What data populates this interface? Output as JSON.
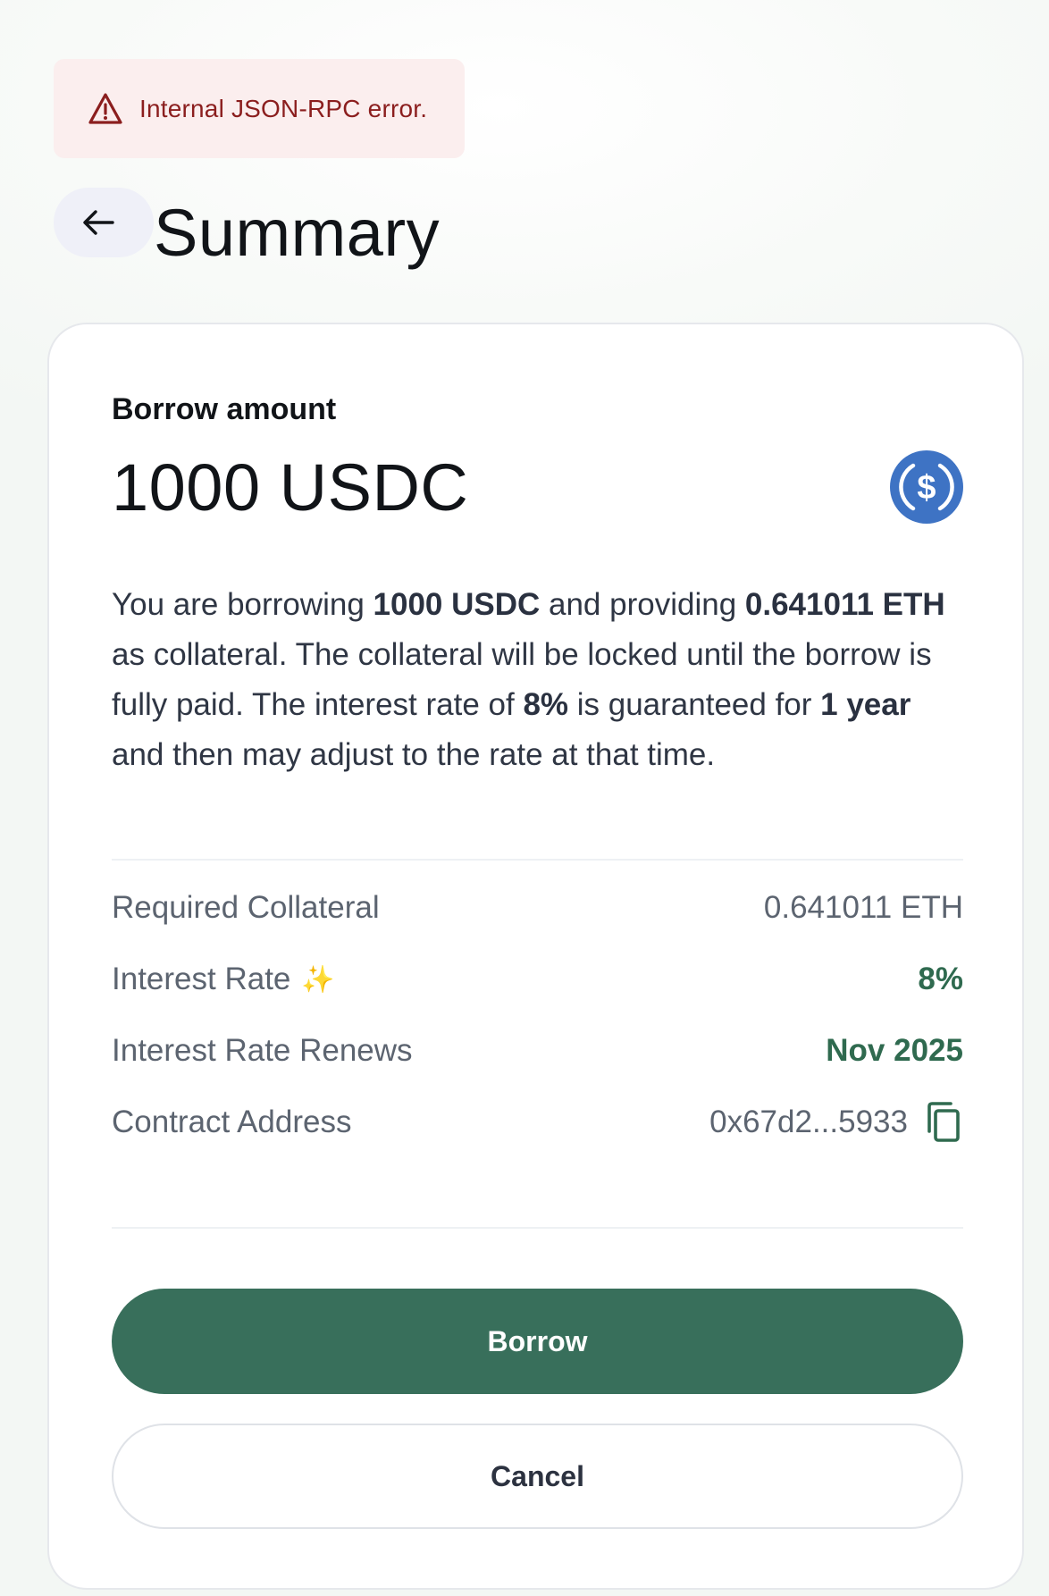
{
  "error_banner": {
    "icon": "warning-triangle-icon",
    "message": "Internal JSON-RPC error.",
    "color": "#8b1e1e",
    "background": "#fbeeee"
  },
  "header": {
    "back_icon": "arrow-left-icon",
    "title": "Summary"
  },
  "summary": {
    "amount_label": "Borrow amount",
    "amount_value": "1000 USDC",
    "token_icon": "usdc-icon",
    "description": {
      "p1": "You are borrowing ",
      "amount": "1000 USDC",
      "p2": " and providing ",
      "collateral": "0.641011 ETH",
      "p3": " as collateral. The collateral will be locked until the borrow is fully paid. The interest rate of ",
      "rate": "8%",
      "p4": " is guaranteed for ",
      "term": "1 year",
      "p5": " and then may adjust to the rate at that time."
    },
    "details": [
      {
        "label": "Required Collateral",
        "value": "0.641011 ETH"
      },
      {
        "label": "Interest Rate",
        "icon": "sparkles-icon",
        "value": "8%"
      },
      {
        "label": "Interest Rate Renews",
        "value": "Nov 2025"
      },
      {
        "label": "Contract Address",
        "value": "0x67d2...5933",
        "icon": "copy-icon"
      }
    ]
  },
  "actions": {
    "borrow_label": "Borrow",
    "cancel_label": "Cancel"
  },
  "colors": {
    "accent_green": "#386f5b",
    "value_green": "#2f6a4f",
    "usdc_blue": "#3e73c4"
  }
}
